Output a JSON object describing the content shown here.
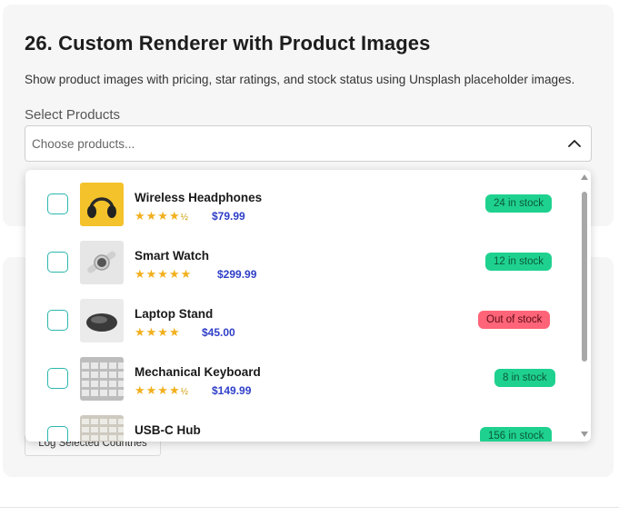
{
  "section": {
    "title": "26. Custom Renderer with Product Images",
    "description": "Show product images with pricing, star ratings, and stock status using Unsplash placeholder images.",
    "field_label": "Select Products",
    "placeholder": "Choose products..."
  },
  "hidden_button": {
    "label": "Log Selected Countries"
  },
  "products": [
    {
      "name": "Wireless Headphones",
      "rating": "★★★★",
      "half": "½",
      "price": "$79.99",
      "stock": "24 in stock",
      "status": "in"
    },
    {
      "name": "Smart Watch",
      "rating": "★★★★★",
      "half": "",
      "price": "$299.99",
      "stock": "12 in stock",
      "status": "in"
    },
    {
      "name": "Laptop Stand",
      "rating": "★★★★",
      "half": "",
      "price": "$45.00",
      "stock": "Out of stock",
      "status": "out"
    },
    {
      "name": "Mechanical Keyboard",
      "rating": "★★★★",
      "half": "½",
      "price": "$149.99",
      "stock": "8 in stock",
      "status": "in"
    },
    {
      "name": "USB-C Hub",
      "rating": "",
      "half": "",
      "price": "",
      "stock": "156 in stock",
      "status": "in"
    }
  ],
  "colors": {
    "in_stock_badge": "#1fd18f",
    "out_of_stock_badge": "#ff6478",
    "price": "#2f3fc8",
    "checkbox_border": "#2bb7ac",
    "star": "#f2b01e"
  },
  "icons": {
    "select_toggle": "chevron-up-icon",
    "scroll_up": "scroll-up-arrow-icon",
    "scroll_down": "scroll-down-arrow-icon"
  }
}
